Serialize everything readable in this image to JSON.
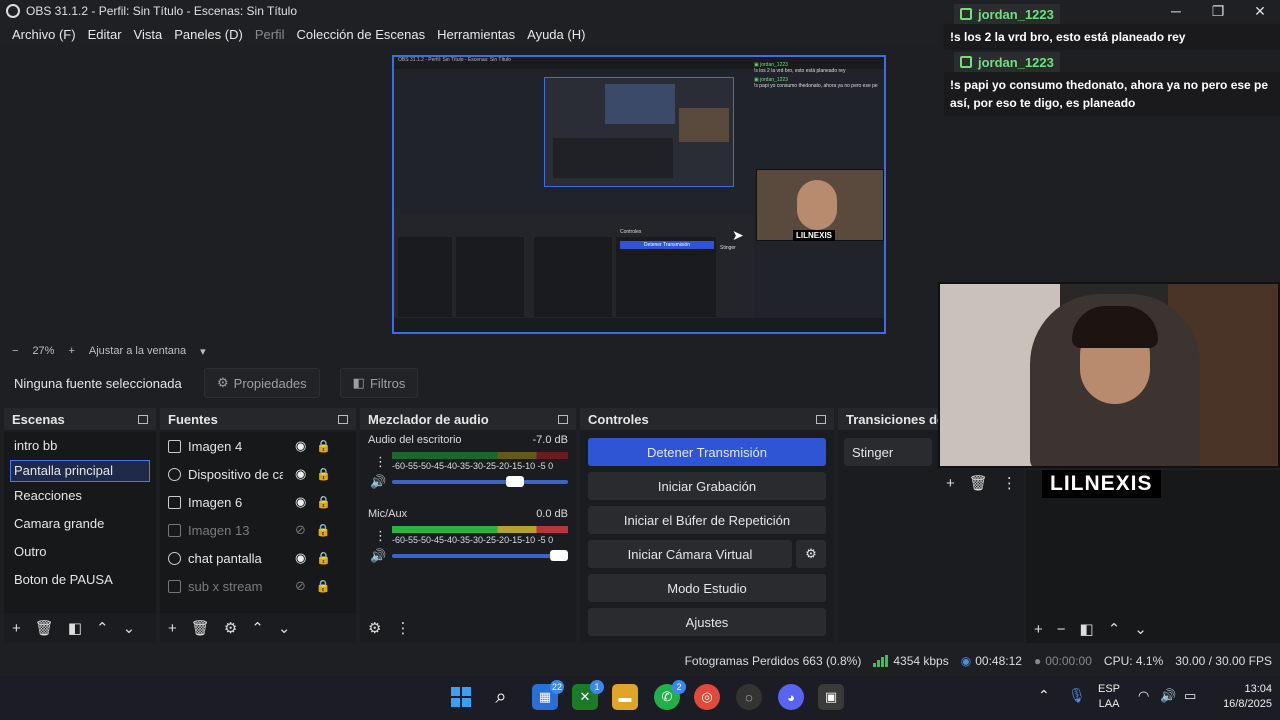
{
  "window": {
    "title": "OBS 31.1.2 - Perfil: Sin Título - Escenas: Sin Título"
  },
  "menu": [
    "Archivo (F)",
    "Editar",
    "Vista",
    "Paneles (D)",
    "Perfil",
    "Colección de Escenas",
    "Herramientas",
    "Ayuda (H)"
  ],
  "preview": {
    "nested_title": "OBS 31.1.2 - Perfil: Sin Título - Escenas: Sin Título",
    "nested_cam_label": "LILNEXIS",
    "nested_controls_label": "Controles",
    "nested_stop_label": "Detener Transmisión",
    "nested_stinger": "Stinger"
  },
  "zoom": {
    "minus": "−",
    "value": "27%",
    "plus": "+",
    "fit_label": "Ajustar a la ventana"
  },
  "source_bar": {
    "no_source": "Ninguna fuente seleccionada",
    "properties": "Propiedades",
    "filters": "Filtros"
  },
  "scenes": {
    "title": "Escenas",
    "items": [
      "intro bb",
      "Pantalla principal",
      "Reacciones",
      "Camara grande",
      "Outro",
      "Boton de PAUSA"
    ],
    "selected_index": 1
  },
  "sources": {
    "title": "Fuentes",
    "items": [
      {
        "name": "Imagen 4",
        "visible": true
      },
      {
        "name": "Dispositivo de captura",
        "visible": true
      },
      {
        "name": "Imagen 6",
        "visible": true
      },
      {
        "name": "Imagen 13",
        "visible": false
      },
      {
        "name": "chat pantalla",
        "visible": true
      },
      {
        "name": "sub x stream",
        "visible": false
      }
    ]
  },
  "mixer": {
    "title": "Mezclador de audio",
    "channels": [
      {
        "name": "Audio del escritorio",
        "db": "-7.0 dB",
        "volume": 0.7
      },
      {
        "name": "Mic/Aux",
        "db": "0.0 dB",
        "volume": 0.95
      }
    ],
    "scale": "-60-55-50-45-40-35-30-25-20-15-10 -5  0"
  },
  "controls": {
    "title": "Controles",
    "stop_stream": "Detener Transmisión",
    "start_recording": "Iniciar Grabación",
    "replay_buffer": "Iniciar el Búfer de Repetición",
    "virtual_cam": "Iniciar Cámara Virtual",
    "studio_mode": "Modo Estudio",
    "settings": "Ajustes"
  },
  "transitions": {
    "title": "Transiciones de escena",
    "selected": "Stinger"
  },
  "webcam": {
    "label": "LILNEXIS"
  },
  "chat": [
    {
      "user": "jordan_1223",
      "message": "!s los 2 la vrd bro, esto está planeado rey"
    },
    {
      "user": "jordan_1223",
      "message": "!s papi yo consumo thedonato, ahora ya no pero ese pe así, por eso te digo, es planeado"
    }
  ],
  "status": {
    "dropped_frames": "Fotogramas Perdidos 663 (0.8%)",
    "bitrate": "4354 kbps",
    "stream_time": "00:48:12",
    "rec_time": "00:00:00",
    "cpu": "CPU: 4.1%",
    "fps": "30.00 / 30.00 FPS"
  },
  "taskbar": {
    "badges": {
      "widgets": "22",
      "xbox": "1",
      "whatsapp": "2"
    },
    "lang": "ESP",
    "lang2": "LAA",
    "time": "13:04",
    "date": "16/8/2025"
  },
  "colors": {
    "accent": "#2f55d4",
    "selection_border": "#4a78f0",
    "chat_user": "#6ee07a"
  }
}
